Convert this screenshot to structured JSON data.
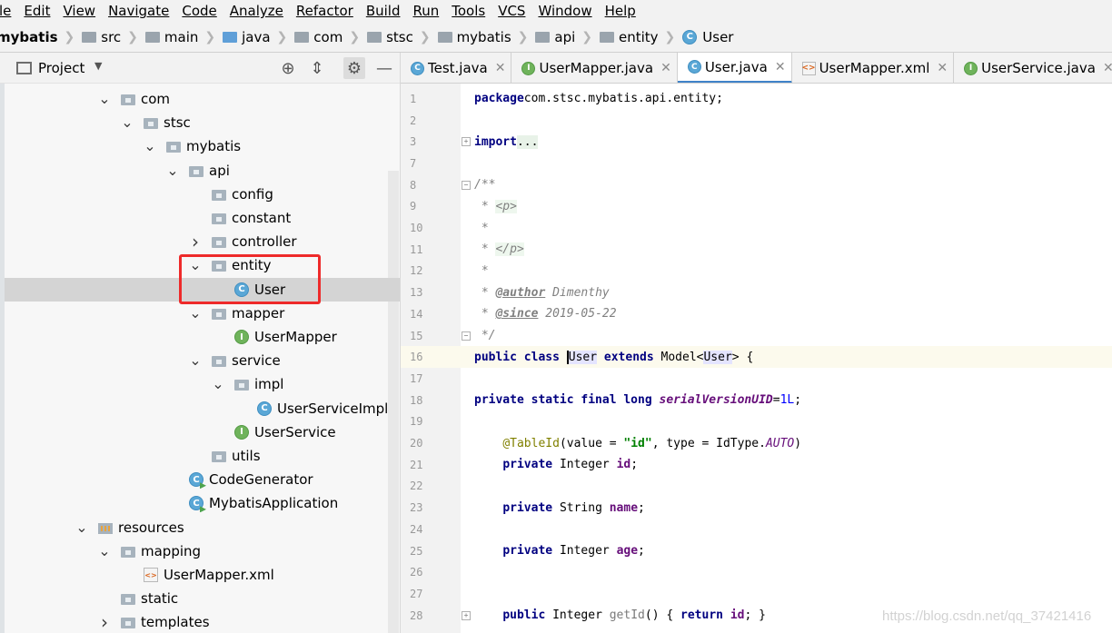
{
  "menu": [
    "le",
    "Edit",
    "View",
    "Navigate",
    "Code",
    "Analyze",
    "Refactor",
    "Build",
    "Run",
    "Tools",
    "VCS",
    "Window",
    "Help"
  ],
  "breadcrumbs": [
    "mybatis",
    "src",
    "main",
    "java",
    "com",
    "stsc",
    "mybatis",
    "api",
    "entity",
    "User"
  ],
  "project_panel": {
    "title": "Project",
    "tree": [
      {
        "label": "com",
        "arrow": "down",
        "icon": "folder-icon",
        "depth": 0
      },
      {
        "label": "stsc",
        "arrow": "down",
        "icon": "folder-icon",
        "depth": 1
      },
      {
        "label": "mybatis",
        "arrow": "down",
        "icon": "folder-icon",
        "depth": 2
      },
      {
        "label": "api",
        "arrow": "down",
        "icon": "folder-icon",
        "depth": 3
      },
      {
        "label": "config",
        "arrow": "none",
        "icon": "folder-icon",
        "depth": 4
      },
      {
        "label": "constant",
        "arrow": "none",
        "icon": "folder-icon",
        "depth": 4
      },
      {
        "label": "controller",
        "arrow": "right",
        "icon": "folder-icon",
        "depth": 4
      },
      {
        "label": "entity",
        "arrow": "down",
        "icon": "folder-icon",
        "depth": 4
      },
      {
        "label": "User",
        "arrow": "none",
        "icon": "class-icon",
        "depth": 5,
        "selected": true
      },
      {
        "label": "mapper",
        "arrow": "down",
        "icon": "folder-icon",
        "depth": 4
      },
      {
        "label": "UserMapper",
        "arrow": "none",
        "icon": "interface-icon",
        "depth": 5
      },
      {
        "label": "service",
        "arrow": "down",
        "icon": "folder-icon",
        "depth": 4
      },
      {
        "label": "impl",
        "arrow": "down",
        "icon": "folder-icon",
        "depth": 5
      },
      {
        "label": "UserServiceImpl",
        "arrow": "none",
        "icon": "class-icon",
        "depth": 6
      },
      {
        "label": "UserService",
        "arrow": "none",
        "icon": "interface-icon",
        "depth": 5
      },
      {
        "label": "utils",
        "arrow": "none",
        "icon": "folder-icon",
        "depth": 4
      },
      {
        "label": "CodeGenerator",
        "arrow": "none",
        "icon": "runnable-class-icon",
        "depth": 3
      },
      {
        "label": "MybatisApplication",
        "arrow": "none",
        "icon": "spring-app-icon",
        "depth": 3
      },
      {
        "label": "resources",
        "arrow": "down",
        "icon": "resources-folder-icon",
        "depth": -1
      },
      {
        "label": "mapping",
        "arrow": "down",
        "icon": "folder-icon",
        "depth": 0
      },
      {
        "label": "UserMapper.xml",
        "arrow": "none",
        "icon": "xml-file-icon",
        "depth": 1
      },
      {
        "label": "static",
        "arrow": "none",
        "icon": "folder-icon",
        "depth": 0
      },
      {
        "label": "templates",
        "arrow": "right",
        "icon": "folder-icon",
        "depth": 0
      }
    ]
  },
  "tabs": [
    {
      "label": "Test.java",
      "icon": "class-icon",
      "active": false
    },
    {
      "label": "UserMapper.java",
      "icon": "interface-icon",
      "active": false
    },
    {
      "label": "User.java",
      "icon": "class-icon",
      "active": true
    },
    {
      "label": "UserMapper.xml",
      "icon": "xml-file-icon",
      "active": false
    },
    {
      "label": "UserService.java",
      "icon": "interface-icon",
      "active": false
    }
  ],
  "editor": {
    "current_line": 16,
    "lines": [
      {
        "n": "1",
        "tokens": [
          [
            "kw",
            "package"
          ],
          [
            "",
            "com.stsc.mybatis.api.entity;"
          ]
        ]
      },
      {
        "n": "2",
        "tokens": []
      },
      {
        "n": "3",
        "tokens": [
          [
            "kw",
            "import"
          ],
          [
            "",
            ""
          ],
          [
            "fold",
            "..."
          ]
        ],
        "fold": "+"
      },
      {
        "n": "7",
        "tokens": []
      },
      {
        "n": "8",
        "tokens": [
          [
            "cm",
            "/**"
          ]
        ],
        "fold": "-"
      },
      {
        "n": "9",
        "tokens": [
          [
            "cm",
            " * "
          ],
          [
            "tag",
            "<p>"
          ]
        ]
      },
      {
        "n": "10",
        "tokens": [
          [
            "cm",
            " *"
          ]
        ]
      },
      {
        "n": "11",
        "tokens": [
          [
            "cm",
            " * "
          ],
          [
            "tag",
            "</p>"
          ]
        ]
      },
      {
        "n": "12",
        "tokens": [
          [
            "cm",
            " *"
          ]
        ]
      },
      {
        "n": "13",
        "tokens": [
          [
            "cm",
            " * "
          ],
          [
            "jdtag",
            "@author"
          ],
          [
            "cm",
            " Dimenthy"
          ]
        ]
      },
      {
        "n": "14",
        "tokens": [
          [
            "cm",
            " * "
          ],
          [
            "jdtag",
            "@since"
          ],
          [
            "cm",
            " 2019-05-22"
          ]
        ]
      },
      {
        "n": "15",
        "tokens": [
          [
            "cm",
            " */"
          ]
        ],
        "fold": "-"
      },
      {
        "n": "16",
        "tokens": [
          [
            "kw",
            "public class "
          ],
          [
            "caret",
            ""
          ],
          [
            "hl",
            "User"
          ],
          [
            "",
            " "
          ],
          [
            "kw",
            "extends "
          ],
          [
            "",
            "Model<"
          ],
          [
            "hl",
            "User"
          ],
          [
            "",
            "> {"
          ]
        ]
      },
      {
        "n": "17",
        "tokens": []
      },
      {
        "n": "18",
        "tokens": [
          [
            "kw",
            "private static final long "
          ],
          [
            "sfld",
            "serialVersionUID"
          ],
          [
            "",
            "="
          ],
          [
            "num",
            "1L"
          ],
          [
            "",
            ";"
          ]
        ]
      },
      {
        "n": "19",
        "tokens": []
      },
      {
        "n": "20",
        "tokens": [
          [
            "",
            "    "
          ],
          [
            "ann",
            "@TableId"
          ],
          [
            "",
            "(value = "
          ],
          [
            "str",
            "\"id\""
          ],
          [
            "",
            ", type = IdType."
          ],
          [
            "enm",
            "AUTO"
          ],
          [
            "",
            ")"
          ]
        ]
      },
      {
        "n": "21",
        "tokens": [
          [
            "",
            "    "
          ],
          [
            "kw",
            "private "
          ],
          [
            "",
            "Integer "
          ],
          [
            "fld",
            "id"
          ],
          [
            "",
            ";"
          ]
        ]
      },
      {
        "n": "22",
        "tokens": []
      },
      {
        "n": "23",
        "tokens": [
          [
            "",
            "    "
          ],
          [
            "kw",
            "private "
          ],
          [
            "",
            "String "
          ],
          [
            "fld",
            "name"
          ],
          [
            "",
            ";"
          ]
        ]
      },
      {
        "n": "24",
        "tokens": []
      },
      {
        "n": "25",
        "tokens": [
          [
            "",
            "    "
          ],
          [
            "kw",
            "private "
          ],
          [
            "",
            "Integer "
          ],
          [
            "fld",
            "age"
          ],
          [
            "",
            ";"
          ]
        ]
      },
      {
        "n": "26",
        "tokens": []
      },
      {
        "n": "27",
        "tokens": []
      },
      {
        "n": "28",
        "tokens": [
          [
            "",
            "    "
          ],
          [
            "kw",
            "public "
          ],
          [
            "",
            "Integer "
          ],
          [
            "meth",
            "getId"
          ],
          [
            "",
            "() { "
          ],
          [
            "kw",
            "return "
          ],
          [
            "fld",
            "id"
          ],
          [
            "",
            "; }"
          ]
        ],
        "fold": "+"
      }
    ]
  },
  "watermark": "https://blog.csdn.net/qq_37421416",
  "colors": {
    "accent": "#4083c9",
    "highlight_box": "#ee2a2a",
    "selection": "#d4d4d4",
    "current_line": "#fcfaed"
  }
}
